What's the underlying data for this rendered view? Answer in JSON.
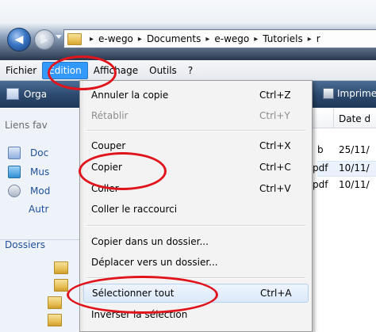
{
  "address": {
    "crumbs": [
      "e-wego",
      "Documents",
      "e-wego",
      "Tutoriels"
    ],
    "separator": "▸",
    "trailing": "r"
  },
  "navigation": {
    "back_icon": "arrow-left-icon",
    "forward_icon": "arrow-right-icon"
  },
  "menubar": {
    "items": [
      "Fichier",
      "Edition",
      "Affichage",
      "Outils",
      "?"
    ],
    "active": "Edition"
  },
  "toolbar": {
    "organize_label": "Orga",
    "print_label": "Imprimer"
  },
  "nav_pane": {
    "favorites_heading": "Liens fav",
    "links": [
      "Doc",
      "Mus",
      "Mod",
      "Autr"
    ],
    "folders_heading": "Dossiers"
  },
  "filelist": {
    "column_date_label": "Date d",
    "rows": [
      {
        "type_fragment": "b",
        "date": "25/11/"
      },
      {
        "type_fragment": "pdf",
        "date": "10/11/"
      },
      {
        "type_fragment": "pdf",
        "date": "10/11/"
      }
    ]
  },
  "edit_menu": {
    "items": [
      {
        "label": "Annuler la copie",
        "shortcut": "Ctrl+Z",
        "disabled": false
      },
      {
        "label": "Rétablir",
        "shortcut": "Ctrl+Y",
        "disabled": true
      },
      {
        "label": "Couper",
        "shortcut": "Ctrl+X",
        "disabled": false
      },
      {
        "label": "Copier",
        "shortcut": "Ctrl+C",
        "disabled": false
      },
      {
        "label": "Coller",
        "shortcut": "Ctrl+V",
        "disabled": false
      },
      {
        "label": "Coller le raccourci",
        "shortcut": "",
        "disabled": false
      },
      {
        "label": "Copier dans un dossier...",
        "shortcut": "",
        "disabled": false
      },
      {
        "label": "Déplacer vers un dossier...",
        "shortcut": "",
        "disabled": false
      },
      {
        "label": "Sélectionner tout",
        "shortcut": "Ctrl+A",
        "disabled": false,
        "highlighted": true
      },
      {
        "label": "Inverser la sélection",
        "shortcut": "",
        "disabled": false
      }
    ]
  },
  "colors": {
    "annotation_red": "#e0141c",
    "menu_highlight": "#3399ff",
    "toolbar_blue": "#2d4b70"
  }
}
